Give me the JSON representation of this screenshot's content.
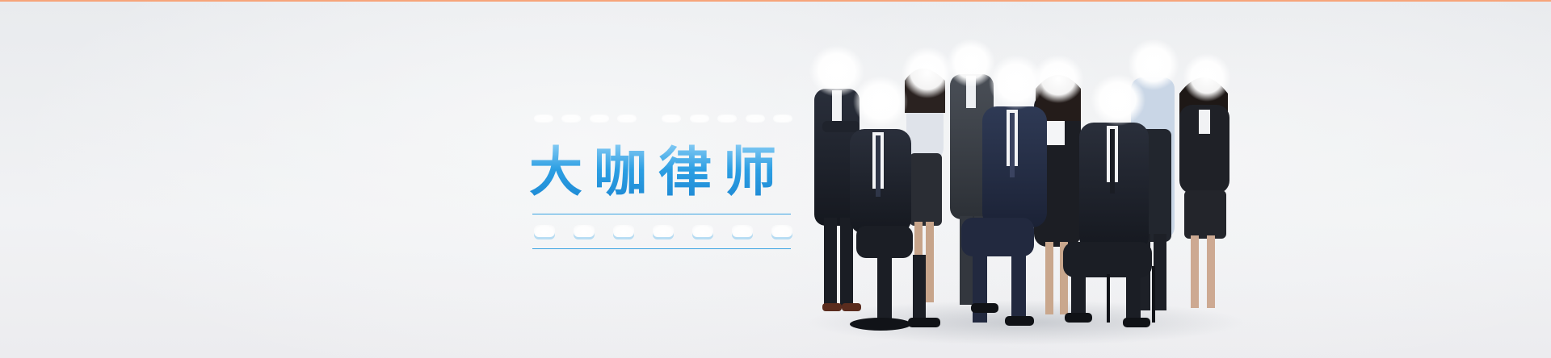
{
  "banner": {
    "title": "大咖律师",
    "colors": {
      "accent_top_line": "#f7a47a",
      "title_blue": "#2aa0e4",
      "rule_blue": "#3aa3e2",
      "background": "#eef0f2"
    }
  },
  "photo": {
    "subject": "group-of-lawyers",
    "people_count": 10
  }
}
